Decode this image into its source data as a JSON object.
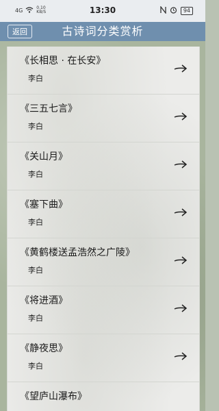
{
  "status_bar": {
    "signal": "4G",
    "speed": "0.10 KB/S",
    "time": "13:30",
    "battery": "94"
  },
  "nav": {
    "back_label": "返回",
    "title": "古诗词分类赏析"
  },
  "items": [
    {
      "title": "《长相思 · 在长安》",
      "author": "李白"
    },
    {
      "title": "《三五七言》",
      "author": "李白"
    },
    {
      "title": "《关山月》",
      "author": "李白"
    },
    {
      "title": "《塞下曲》",
      "author": "李白"
    },
    {
      "title": "《黄鹤楼送孟浩然之广陵》",
      "author": "李白"
    },
    {
      "title": "《将进酒》",
      "author": "李白"
    },
    {
      "title": "《静夜思》",
      "author": "李白"
    },
    {
      "title": "《望庐山瀑布》",
      "author": ""
    }
  ],
  "colors": {
    "nav_background": "#6f8fae",
    "panel_background": "#ececea"
  }
}
